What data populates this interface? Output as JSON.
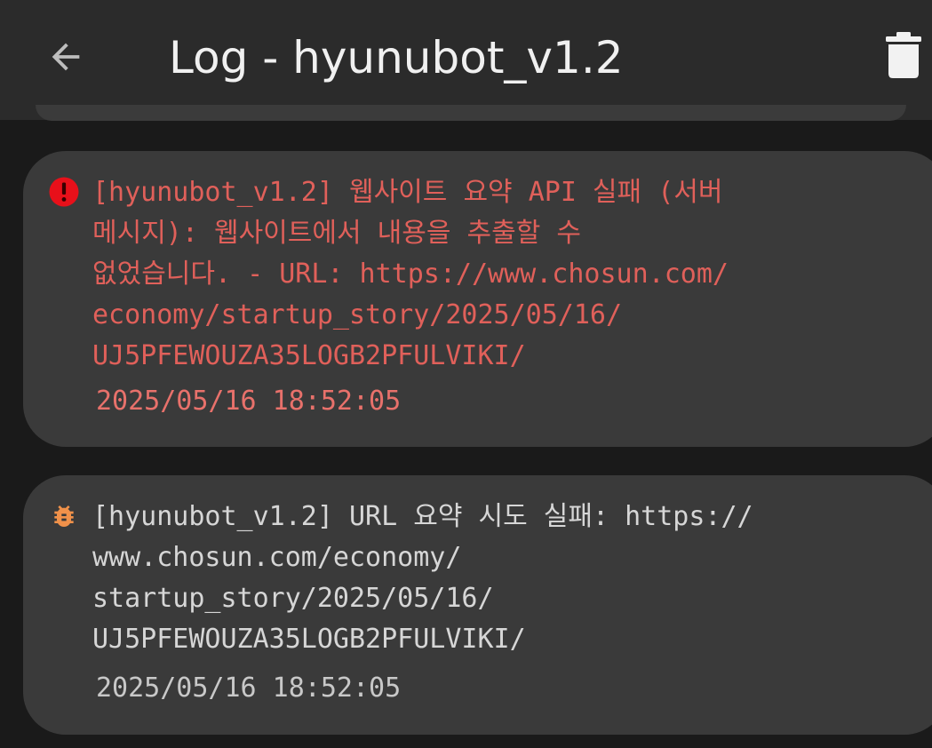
{
  "app_bar": {
    "back_icon": "arrow-left-icon",
    "title": "Log - hyunubot_v1.2",
    "delete_icon": "trash-icon"
  },
  "colors": {
    "app_bar_bg": "#2b2b2b",
    "background": "#1a1a1a",
    "card_bg": "#3a3a3a",
    "error_text": "#e0605a",
    "error_icon": "#e8101a",
    "debug_icon": "#f0914a",
    "normal_text": "#d6d6d6"
  },
  "logs": [
    {
      "level": "error",
      "icon": "error-circle-icon",
      "message": "[hyunubot_v1.2] 웹사이트 요약 API 실패 (서버\n메시지): 웹사이트에서 내용을 추출할 수\n없었습니다. - URL: https://www.chosun.com/\neconomy/startup_story/2025/05/16/\nUJ5PFEWOUZA35LOGB2PFULVIKI/",
      "timestamp": "2025/05/16 18:52:05"
    },
    {
      "level": "debug",
      "icon": "bug-icon",
      "message": "[hyunubot_v1.2] URL 요약 시도 실패: https://\nwww.chosun.com/economy/\nstartup_story/2025/05/16/\nUJ5PFEWOUZA35LOGB2PFULVIKI/",
      "timestamp": "2025/05/16 18:52:05"
    }
  ]
}
